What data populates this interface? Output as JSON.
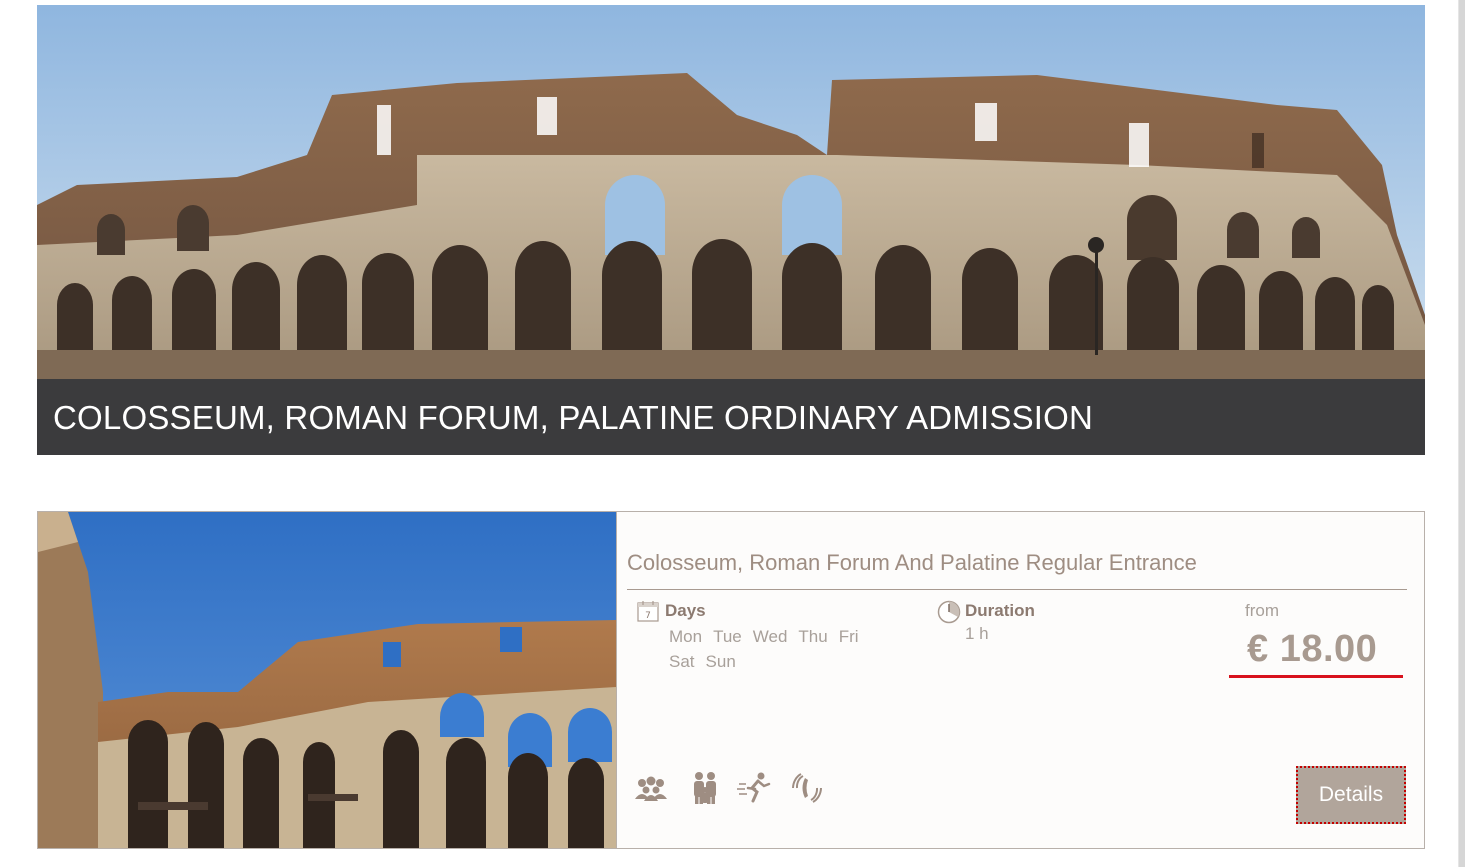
{
  "hero": {
    "title": "COLOSSEUM, ROMAN FORUM, PALATINE ORDINARY ADMISSION"
  },
  "tour": {
    "title": "Colosseum, Roman Forum And Palatine Regular Entrance",
    "days_label": "Days",
    "days": [
      "Mon",
      "Tue",
      "Wed",
      "Thu",
      "Fri",
      "Sat",
      "Sun"
    ],
    "duration_label": "Duration",
    "duration_value": "1 h",
    "price_from_label": "from",
    "price": "€ 18.00",
    "details_label": "Details",
    "calendar_icon_text": "7",
    "feature_icons": [
      "group-icon",
      "family-icon",
      "skip-line-icon",
      "phone-icon"
    ]
  },
  "colors": {
    "caption_bg": "#3b3b3d",
    "accent_brown": "#9e8d82",
    "price_underline": "#d8121d",
    "button_bg": "#b1a59b"
  }
}
